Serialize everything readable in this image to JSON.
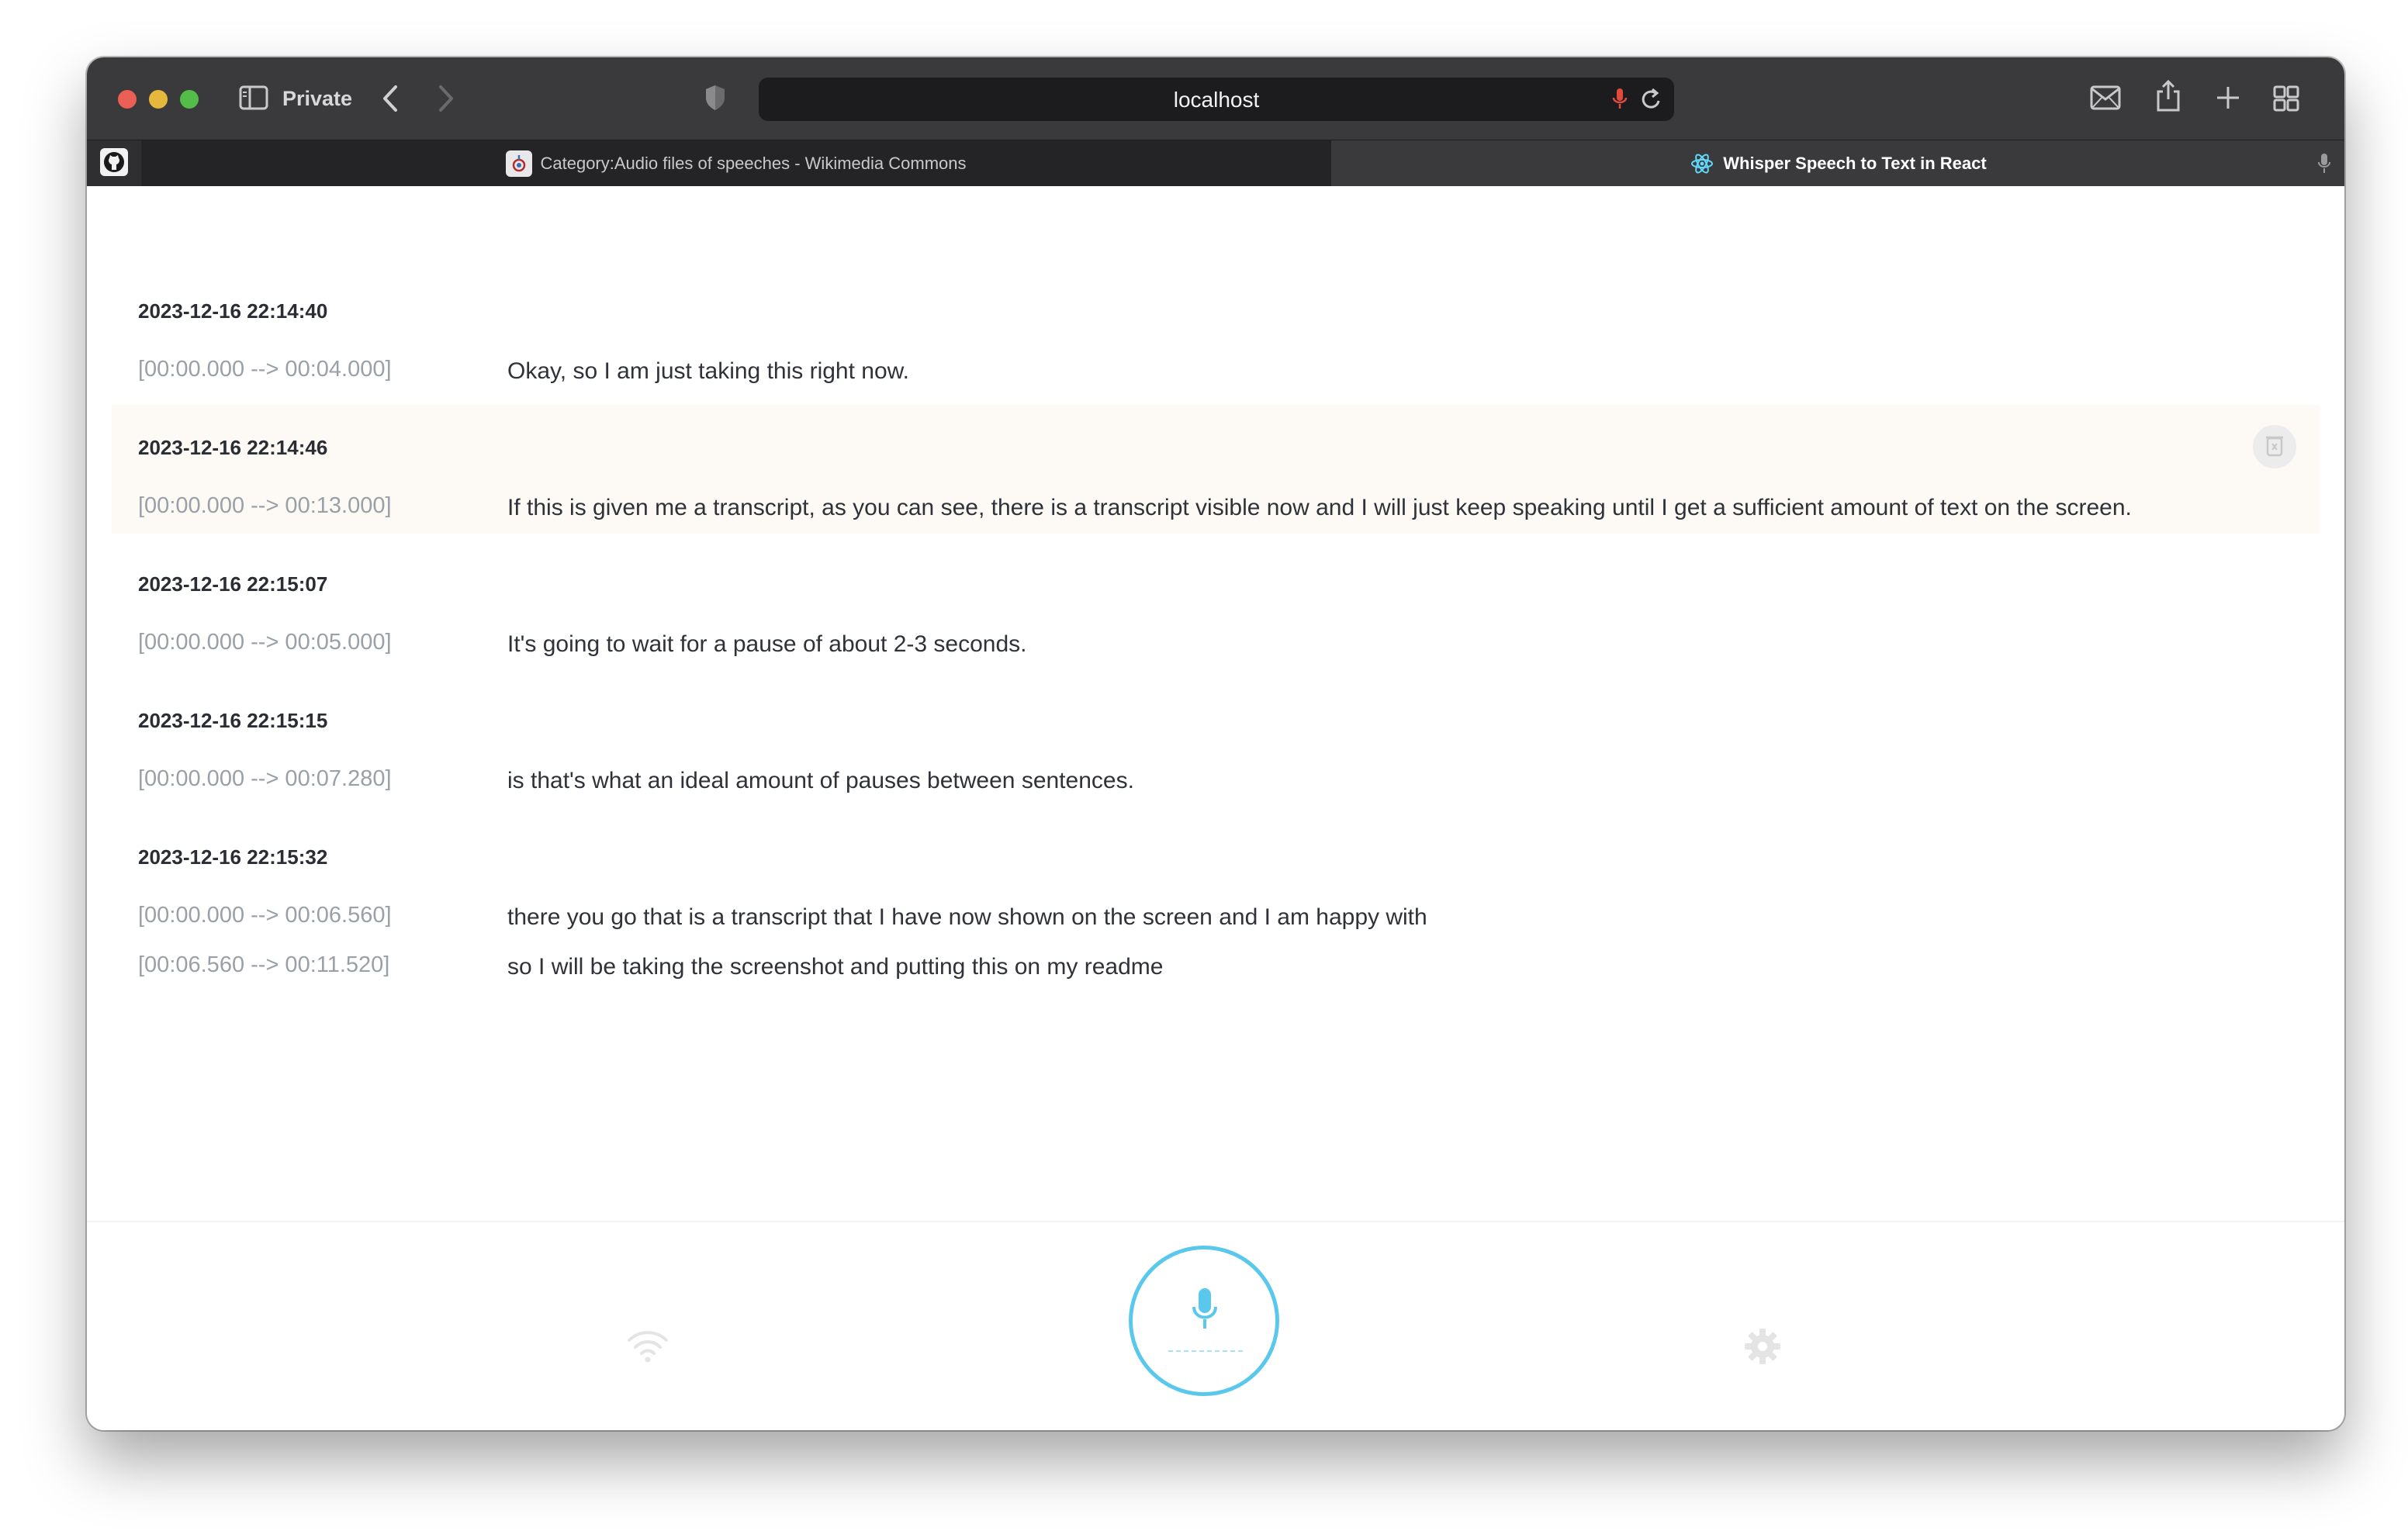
{
  "browser": {
    "private_label": "Private",
    "url": "localhost",
    "tabs": [
      {
        "label": "Category:Audio files of speeches - Wikimedia Commons",
        "active": false
      },
      {
        "label": "Whisper Speech to Text in React",
        "active": true
      }
    ],
    "icons": [
      "sidebar-icon",
      "back-icon",
      "forward-icon",
      "shield-icon",
      "mic-icon",
      "reload-icon",
      "mail-icon",
      "share-icon",
      "new-tab-icon",
      "tab-overview-icon",
      "github-icon"
    ]
  },
  "transcripts": [
    {
      "timestamp": "2023-12-16 22:14:40",
      "lines": [
        {
          "range": "[00:00.000 --> 00:04.000]",
          "text": "Okay, so I am just taking this right now."
        }
      ]
    },
    {
      "timestamp": "2023-12-16 22:14:46",
      "lines": [
        {
          "range": "[00:00.000 --> 00:13.000]",
          "text": "If this is given me a transcript, as you can see, there is a transcript visible now and I will just keep speaking until I get a sufficient amount of text on the screen."
        }
      ]
    },
    {
      "timestamp": "2023-12-16 22:15:07",
      "lines": [
        {
          "range": "[00:00.000 --> 00:05.000]",
          "text": "It's going to wait for a pause of about 2-3 seconds."
        }
      ]
    },
    {
      "timestamp": "2023-12-16 22:15:15",
      "lines": [
        {
          "range": "[00:00.000 --> 00:07.280]",
          "text": "is that's what an ideal amount of pauses between sentences."
        }
      ]
    },
    {
      "timestamp": "2023-12-16 22:15:32",
      "lines": [
        {
          "range": "[00:00.000 --> 00:06.560]",
          "text": "there you go that is a transcript that I have now shown on the screen and I am happy with"
        },
        {
          "range": "[00:06.560 --> 00:11.520]",
          "text": "so I will be taking the screenshot and putting this on my readme"
        }
      ]
    }
  ],
  "footer": {
    "icons": [
      "wifi-icon",
      "microphone-icon",
      "settings-icon"
    ]
  },
  "colors": {
    "accent": "#5ac8ec",
    "highlight_row": "#fdf9f4",
    "toolbar": "#3a3a3c"
  }
}
